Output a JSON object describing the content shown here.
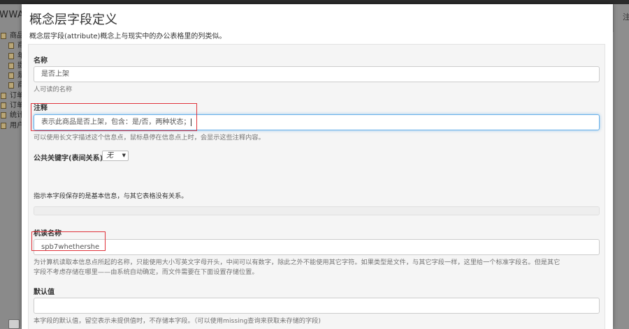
{
  "background": {
    "brand_text": "WWAF",
    "tree_items": [
      {
        "label": "商品"
      },
      {
        "label": "商"
      },
      {
        "label": "年"
      },
      {
        "label": "提"
      },
      {
        "label": "是"
      },
      {
        "label": "商"
      },
      {
        "label": "订单"
      },
      {
        "label": "订单"
      },
      {
        "label": "统计"
      },
      {
        "label": "用户"
      }
    ],
    "right_text": "注"
  },
  "modal": {
    "title": "概念层字段定义",
    "description": "概念层字段(attribute)概念上与现实中的办公表格里的列类似。",
    "fields": {
      "name": {
        "label": "名称",
        "value": "是否上架",
        "help": "人可读的名称"
      },
      "comment": {
        "label": "注释",
        "value": "表示此商品是否上架，包含：是/否，两种状态；",
        "help": "可以使用长文字描述这个信息点，鼠标悬停在信息点上时，会显示这些注释内容。"
      },
      "foreign_key": {
        "label": "公共关键字(表间关系)",
        "selected": "无",
        "help": "指示本字段保存的是基本信息，与其它表格没有关系。"
      },
      "machine_name": {
        "label": "机读名称",
        "value": "spb7whethershe",
        "help_line1": "为计算机读取本信息点所起的名称，只能使用大小写英文字母开头，中间可以有数字，除此之外不能使用其它字符。如果类型是文件，与其它字段一样，这里给一个标准字段名。但是其它",
        "help_line2": "字段不考虑存储在哪里——由系统自动确定，而文件需要在下面设置存储位置。"
      },
      "default_value": {
        "label": "默认值",
        "value": "",
        "help": "本字段的默认值，留空表示未提供值时，不存储本字段。（可以使用missing查询来获取未存储的字段)"
      }
    }
  },
  "colors": {
    "annotation": "#e0333b",
    "focus": "#66afe9"
  }
}
